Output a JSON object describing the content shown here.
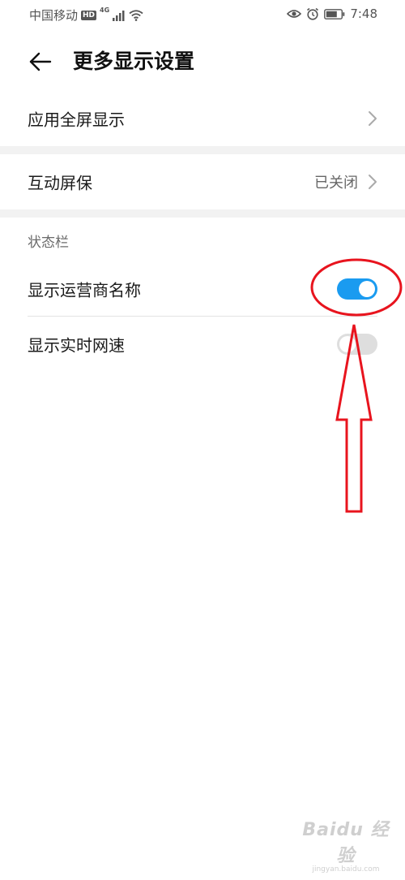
{
  "status_bar": {
    "carrier": "中国移动",
    "hd": "HD",
    "network": "4G",
    "time": "7:48",
    "icons": [
      "signal-icon",
      "wifi-icon",
      "eye-icon",
      "alarm-icon",
      "battery-icon"
    ]
  },
  "header": {
    "title": "更多显示设置",
    "back_icon": "back-arrow-icon"
  },
  "rows": {
    "fullscreen_label": "应用全屏显示",
    "screensaver_label": "互动屏保",
    "screensaver_value": "已关闭"
  },
  "status_section": {
    "title": "状态栏",
    "carrier_name_label": "显示运营商名称",
    "carrier_name_on": true,
    "net_speed_label": "显示实时网速",
    "net_speed_on": false
  },
  "watermark": {
    "logo": "Baidu 经验",
    "url": "jingyan.baidu.com"
  },
  "colors": {
    "toggle_on": "#1a9bf0",
    "toggle_off": "#dedede",
    "annotation": "#e8141e",
    "divider_band": "#f2f2f2"
  }
}
